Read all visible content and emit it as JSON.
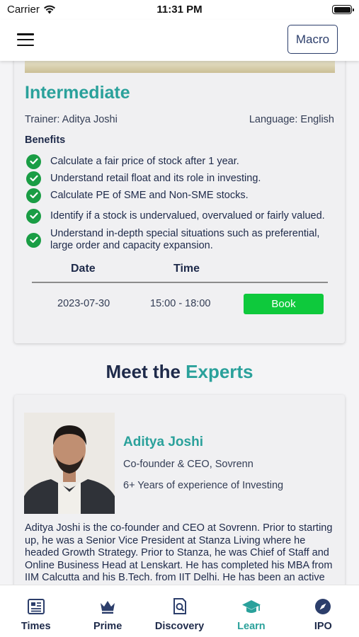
{
  "status_bar": {
    "carrier": "Carrier",
    "time": "11:31 PM"
  },
  "header": {
    "macro_label": "Macro"
  },
  "course": {
    "title": "Intermediate",
    "trainer": "Trainer: Aditya Joshi",
    "language": "Language: English",
    "benefits_heading": "Benefits",
    "benefits": [
      "Calculate a fair price of stock after 1 year.",
      "Understand retail float and its role in investing.",
      "Calculate PE of SME and Non-SME stocks.",
      "Identify if a stock is undervalued, overvalued or fairly valued.",
      "Understand in-depth special situations such as preferential, large order and capacity expansion."
    ],
    "schedule": {
      "date_header": "Date",
      "time_header": "Time",
      "rows": [
        {
          "date": "2023-07-30",
          "time": "15:00 - 18:00",
          "book_label": "Book"
        }
      ]
    }
  },
  "experts": {
    "heading_part1": "Meet the ",
    "heading_part2": "Experts",
    "items": [
      {
        "name": "Aditya Joshi",
        "role": "Co-founder & CEO, Sovrenn",
        "experience": "6+ Years of experience of Investing",
        "bio": "Aditya Joshi is the co-founder and CEO at Sovrenn. Prior to starting up, he was a Senior Vice President at Stanza Living where he headed Growth Strategy. Prior to Stanza, he was Chief of Staff and Online Business Head at Lenskart. He has completed his MBA from IIM Calcutta and his B.Tech. from IIT Delhi. He has been an active Silicon Valley-style angel investor."
      }
    ]
  },
  "tab_bar": {
    "tabs": [
      {
        "label": "Times",
        "icon": "newspaper-icon",
        "active": false
      },
      {
        "label": "Prime",
        "icon": "crown-icon",
        "active": false
      },
      {
        "label": "Discovery",
        "icon": "search-document-icon",
        "active": false
      },
      {
        "label": "Learn",
        "icon": "graduation-cap-icon",
        "active": true
      },
      {
        "label": "IPO",
        "icon": "compass-icon",
        "active": false
      }
    ]
  },
  "colors": {
    "accent_teal": "#2aa19b",
    "navy_text": "#1e2a4a",
    "check_green": "#1a9d45",
    "book_green": "#0ec93c"
  }
}
